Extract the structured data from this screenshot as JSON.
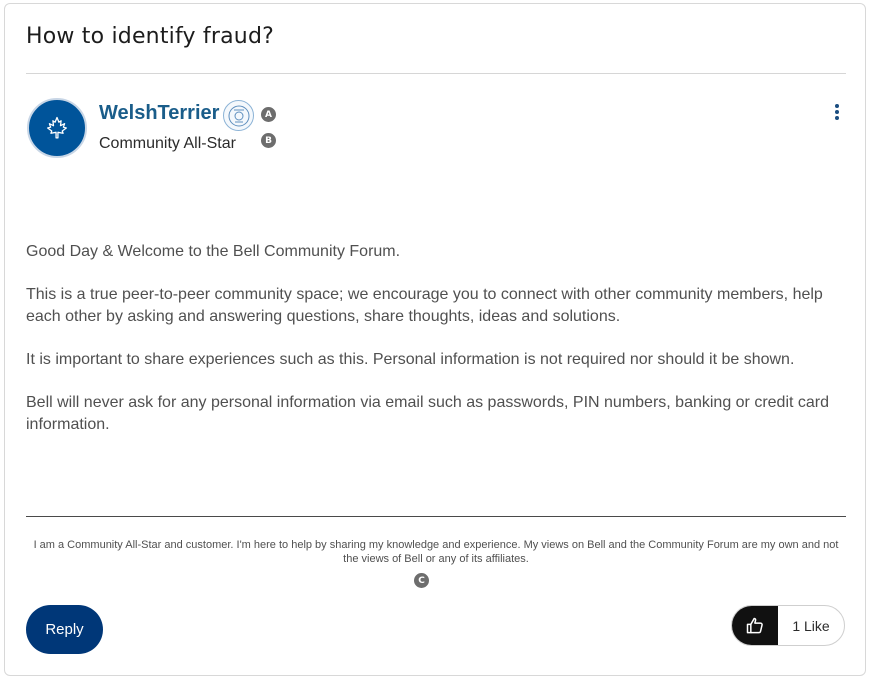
{
  "post": {
    "title": "How to identify fraud?",
    "author": {
      "name": "WelshTerrier",
      "rank": "Community All-Star"
    },
    "markers": {
      "a": "A",
      "b": "B",
      "c": "C"
    },
    "body": [
      "Good Day & Welcome to the Bell Community Forum.",
      "This is a true peer-to-peer community space; we encourage you to connect with other community members, help each other by asking and answering questions, share thoughts, ideas and solutions.",
      "It is important to share experiences such as this. Personal information is not required nor should it be shown.",
      "Bell will never ask for any personal information via email such as passwords, PIN numbers, banking or credit card information."
    ],
    "signature": "I am a Community All-Star and customer. I'm here to help by sharing my knowledge and experience. My views on Bell and the Community Forum are my own and not the views of Bell or any of its affiliates."
  },
  "actions": {
    "reply_label": "Reply",
    "like_label": "1 Like"
  },
  "icons": {
    "avatar": "maple-leaf-icon",
    "rank_badge": "all-star-badge-icon",
    "menu": "vertical-ellipsis-icon",
    "like": "thumbs-up-icon"
  },
  "colors": {
    "brand_blue": "#00549a",
    "username": "#1a5d8a",
    "reply_button": "#003778",
    "like_button": "#111111"
  }
}
